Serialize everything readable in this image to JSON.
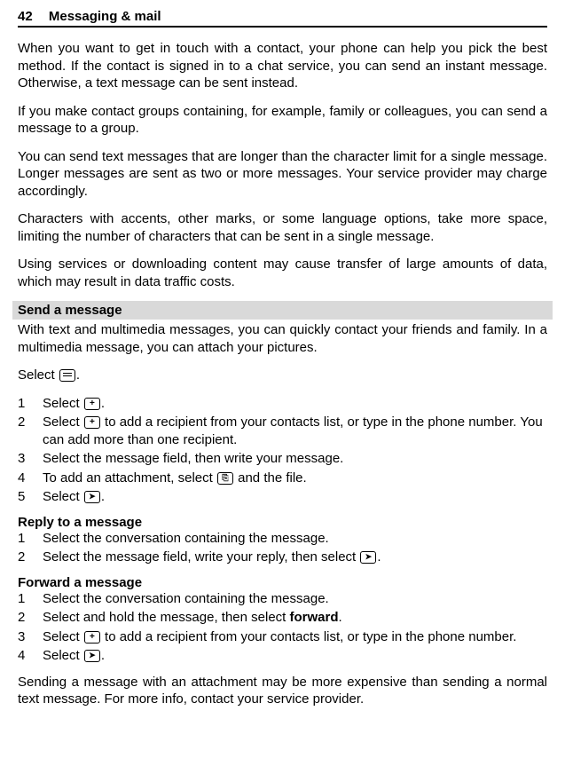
{
  "header": {
    "page_num": "42",
    "title": "Messaging & mail"
  },
  "intro": {
    "p1": "When you want to get in touch with a contact, your phone can help you pick the best method. If the contact is signed in to a chat service, you can send an instant message. Otherwise, a text message can be sent instead.",
    "p2": "If you make contact groups containing, for example, family or colleagues, you can send a message to a group.",
    "p3": "You can send text messages that are longer than the character limit for a single message. Longer messages are sent as two or more messages. Your service provider may charge accordingly.",
    "p4": "Characters with accents, other marks, or some language options, take more space, limiting the number of characters that can be sent in a single message.",
    "p5": "Using services or downloading content may cause transfer of large amounts of data, which may result in data traffic costs."
  },
  "send": {
    "heading": "Send a message",
    "intro": "With text and multimedia messages, you can quickly contact your friends and family. In a multimedia message, you can attach your pictures.",
    "select_pre": "Select ",
    "select_post": ".",
    "steps": {
      "s1_pre": "Select ",
      "s1_post": ".",
      "s2_pre": "Select ",
      "s2_post": " to add a recipient from your contacts list, or type in the phone number. You can add more than one recipient.",
      "s3": "Select the message field, then write your message.",
      "s4_pre": "To add an attachment, select ",
      "s4_post": " and the file.",
      "s5_pre": "Select ",
      "s5_post": "."
    }
  },
  "reply": {
    "heading": "Reply to a message",
    "s1": "Select the conversation containing the message.",
    "s2_pre": "Select the message field, write your reply, then select ",
    "s2_post": "."
  },
  "forward": {
    "heading": "Forward a message",
    "s1": "Select the conversation containing the message.",
    "s2_pre": "Select and hold the message, then select ",
    "s2_kw": "forward",
    "s2_post": ".",
    "s3_pre": "Select ",
    "s3_post": " to add a recipient from your contacts list, or type in the phone number.",
    "s4_pre": "Select ",
    "s4_post": "."
  },
  "footnote": "Sending a message with an attachment may be more expensive than sending a normal text message. For more info, contact your service provider."
}
